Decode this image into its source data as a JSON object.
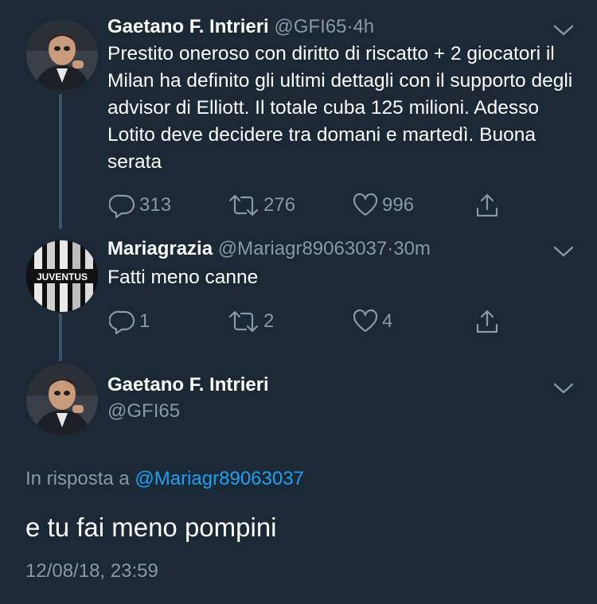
{
  "colors": {
    "background": "#1b2836",
    "text_primary": "#ffffff",
    "text_secondary": "#8899a6",
    "link": "#1da1f2",
    "thread_line": "#3d5466"
  },
  "icons": {
    "reply": "reply-icon",
    "retweet": "retweet-icon",
    "like": "heart-icon",
    "share": "share-icon",
    "menu": "chevron-down-icon"
  },
  "thread": [
    {
      "name": "Gaetano F. Intrieri",
      "handle": "@GFI65",
      "separator": "·",
      "time": "4h",
      "text": "Prestito oneroso con diritto di riscatto + 2 giocatori il Milan ha definito gli ultimi dettagli con il supporto degli advisor di Elliott. Il totale cuba 125 milioni. Adesso Lotito deve decidere tra domani e martedì. Buona serata",
      "replies": "313",
      "retweets": "276",
      "likes": "996"
    },
    {
      "name": "Mariagrazia",
      "handle": "@Mariagr89063037",
      "separator": "·",
      "time": "30m",
      "text": "Fatti meno canne",
      "avatar_text": "JUVENTUS",
      "replies": "1",
      "retweets": "2",
      "likes": "4"
    }
  ],
  "focused": {
    "name": "Gaetano F. Intrieri",
    "handle": "@GFI65",
    "reply_prefix": "In risposta a",
    "reply_to": "@Mariagr89063037",
    "text": "e tu fai meno pompini",
    "timestamp": "12/08/18, 23:59"
  }
}
